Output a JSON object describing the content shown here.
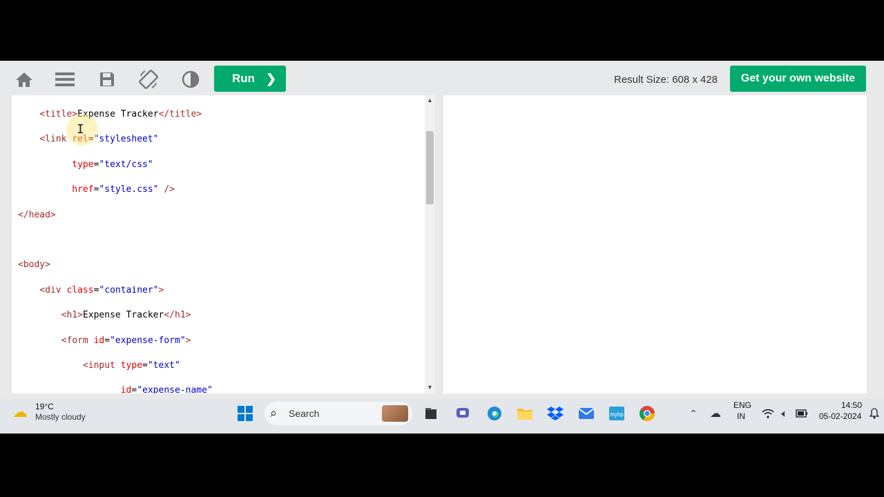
{
  "toolbar": {
    "icons": [
      "home-icon",
      "menu-icon",
      "save-icon",
      "rotate-icon",
      "contrast-icon"
    ],
    "run_label": "Run",
    "result_size": "Result Size: 608 x 428",
    "get_website_label": "Get your own website"
  },
  "code": {
    "lines": [
      {
        "indent": "    ",
        "parts": [
          {
            "t": "tag",
            "s": "<title>"
          },
          {
            "t": "text",
            "s": "Expense Tracker"
          },
          {
            "t": "tag",
            "s": "</title>"
          }
        ]
      },
      {
        "indent": "    ",
        "parts": [
          {
            "t": "tag",
            "s": "<link "
          },
          {
            "t": "attr",
            "s": "rel"
          },
          {
            "t": "text",
            "s": "="
          },
          {
            "t": "val",
            "s": "\"stylesheet\""
          }
        ]
      },
      {
        "indent": "          ",
        "parts": [
          {
            "t": "attr",
            "s": "type"
          },
          {
            "t": "text",
            "s": "="
          },
          {
            "t": "val",
            "s": "\"text/css\""
          }
        ]
      },
      {
        "indent": "          ",
        "parts": [
          {
            "t": "attr",
            "s": "href"
          },
          {
            "t": "text",
            "s": "="
          },
          {
            "t": "val",
            "s": "\"style.css\""
          },
          {
            "t": "tag",
            "s": " />"
          }
        ]
      },
      {
        "indent": "",
        "parts": [
          {
            "t": "tag",
            "s": "</head>"
          }
        ]
      },
      {
        "indent": "",
        "parts": []
      },
      {
        "indent": "",
        "parts": [
          {
            "t": "tag",
            "s": "<body>"
          }
        ]
      },
      {
        "indent": "    ",
        "parts": [
          {
            "t": "tag",
            "s": "<div "
          },
          {
            "t": "attr",
            "s": "class"
          },
          {
            "t": "text",
            "s": "="
          },
          {
            "t": "val",
            "s": "\"container\""
          },
          {
            "t": "tag",
            "s": ">"
          }
        ]
      },
      {
        "indent": "        ",
        "parts": [
          {
            "t": "tag",
            "s": "<h1>"
          },
          {
            "t": "text",
            "s": "Expense Tracker"
          },
          {
            "t": "tag",
            "s": "</h1>"
          }
        ]
      },
      {
        "indent": "        ",
        "parts": [
          {
            "t": "tag",
            "s": "<form "
          },
          {
            "t": "attr",
            "s": "id"
          },
          {
            "t": "text",
            "s": "="
          },
          {
            "t": "val",
            "s": "\"expense-form\""
          },
          {
            "t": "tag",
            "s": ">"
          }
        ]
      },
      {
        "indent": "            ",
        "parts": [
          {
            "t": "tag",
            "s": "<input "
          },
          {
            "t": "attr",
            "s": "type"
          },
          {
            "t": "text",
            "s": "="
          },
          {
            "t": "val",
            "s": "\"text\""
          }
        ]
      },
      {
        "indent": "                   ",
        "parts": [
          {
            "t": "attr",
            "s": "id"
          },
          {
            "t": "text",
            "s": "="
          },
          {
            "t": "val",
            "s": "\"expense-name\""
          }
        ]
      }
    ]
  },
  "taskbar": {
    "weather_temp": "19°C",
    "weather_desc": "Mostly cloudy",
    "search_label": "Search",
    "lang_top": "ENG",
    "lang_bottom": "IN",
    "time": "14:50",
    "date": "05-02-2024"
  }
}
